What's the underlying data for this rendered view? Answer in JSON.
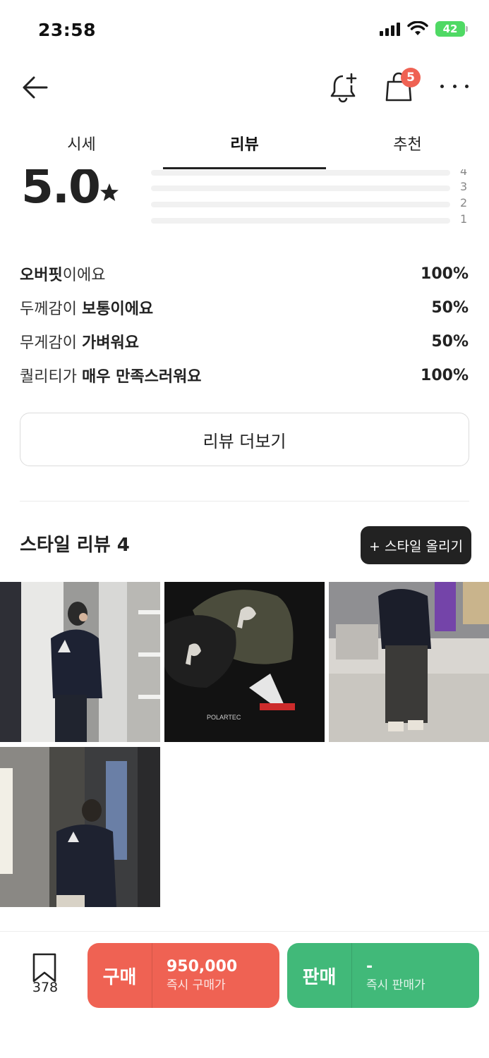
{
  "status_bar": {
    "time": "23:58",
    "battery": "42"
  },
  "nav": {
    "cart_badge": "5"
  },
  "tabs": [
    {
      "label": "시세",
      "active": false
    },
    {
      "label": "리뷰",
      "active": true
    },
    {
      "label": "추천",
      "active": false
    }
  ],
  "rating": {
    "score": "5.0",
    "distribution": [
      {
        "label": "4",
        "fraction": 0.0
      },
      {
        "label": "3",
        "fraction": 0.0
      },
      {
        "label": "2",
        "fraction": 0.0
      },
      {
        "label": "1",
        "fraction": 0.0
      }
    ]
  },
  "summary": [
    {
      "pre": "",
      "bold": "오버핏",
      "post": "이에요",
      "percent": "100%"
    },
    {
      "pre": "두께감이 ",
      "bold": "보통이에요",
      "post": "",
      "percent": "50%"
    },
    {
      "pre": "무게감이 ",
      "bold": "가벼워요",
      "post": "",
      "percent": "50%"
    },
    {
      "pre": "퀄리티가 ",
      "bold": "매우 만족스러워요",
      "post": "",
      "percent": "100%"
    }
  ],
  "more_reviews_label": "리뷰 더보기",
  "style_review": {
    "title": "스타일 리뷰 4",
    "upload_label": "+ 스타일 올리기"
  },
  "bottom": {
    "bookmark_count": "378",
    "buy": {
      "label": "구매",
      "price": "950,000",
      "sub": "즉시 구매가"
    },
    "sell": {
      "label": "판매",
      "price": "-",
      "sub": "즉시 판매가"
    }
  },
  "colors": {
    "buy": "#ef6253",
    "sell": "#41b979",
    "badge": "#ef6253",
    "dark_button": "#222222"
  }
}
